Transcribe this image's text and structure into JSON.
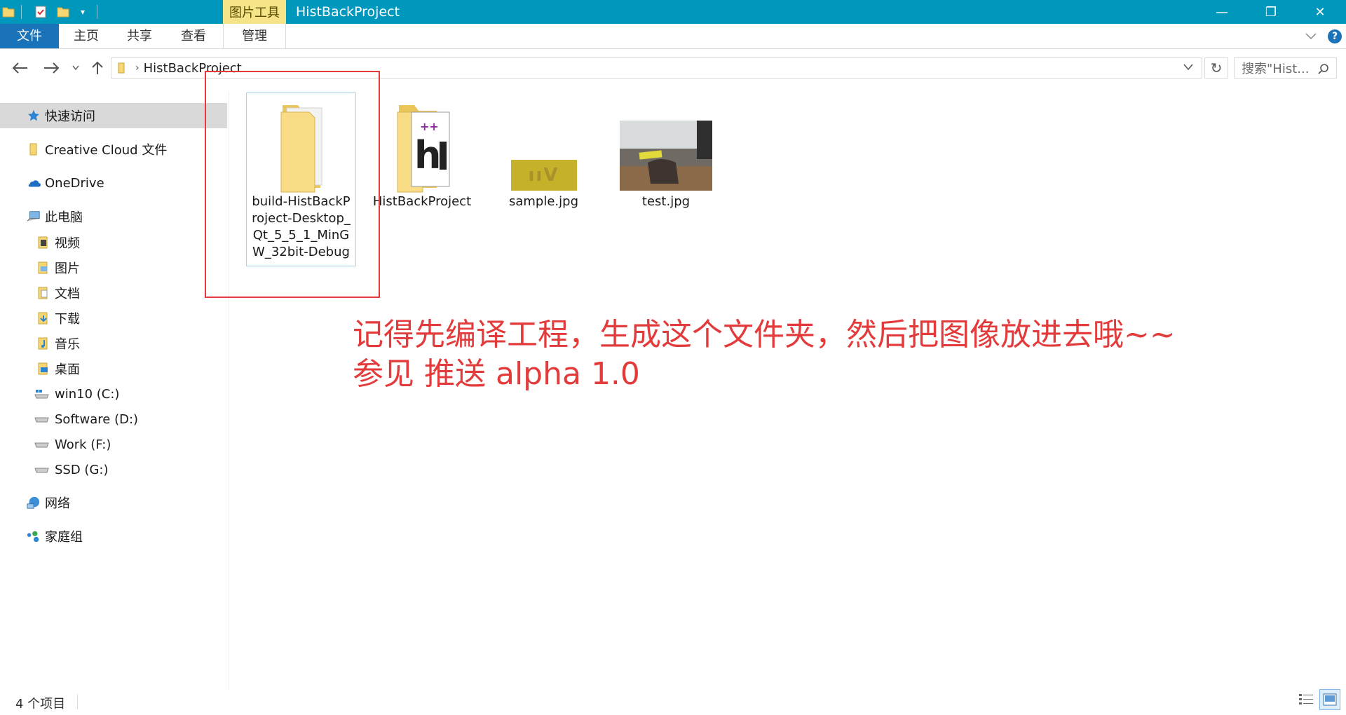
{
  "titlebar": {
    "context_tab": "图片工具",
    "window_title": "HistBackProject",
    "minimize": "—",
    "restore": "❐",
    "close": "✕"
  },
  "ribbon": {
    "tabs": [
      "文件",
      "主页",
      "共享",
      "查看",
      "管理"
    ],
    "help": "?"
  },
  "address": {
    "path": "HistBackProject",
    "search_placeholder": "搜索\"Hist..."
  },
  "sidebar": {
    "items": [
      {
        "label": "快速访问",
        "icon": "star-icon"
      },
      {
        "label": "Creative Cloud 文件",
        "icon": "folder-icon"
      },
      {
        "label": "OneDrive",
        "icon": "cloud-icon"
      },
      {
        "label": "此电脑",
        "icon": "computer-icon"
      },
      {
        "label": "视频",
        "icon": "video-folder-icon"
      },
      {
        "label": "图片",
        "icon": "pictures-folder-icon"
      },
      {
        "label": "文档",
        "icon": "documents-folder-icon"
      },
      {
        "label": "下载",
        "icon": "downloads-folder-icon"
      },
      {
        "label": "音乐",
        "icon": "music-folder-icon"
      },
      {
        "label": "桌面",
        "icon": "desktop-folder-icon"
      },
      {
        "label": "win10 (C:)",
        "icon": "drive-icon"
      },
      {
        "label": "Software (D:)",
        "icon": "drive-icon"
      },
      {
        "label": "Work (F:)",
        "icon": "drive-icon"
      },
      {
        "label": "SSD (G:)",
        "icon": "drive-icon"
      },
      {
        "label": "网络",
        "icon": "network-icon"
      },
      {
        "label": "家庭组",
        "icon": "homegroup-icon"
      }
    ]
  },
  "files": [
    {
      "label": "build-HistBackProject-Desktop_Qt_5_5_1_MinGW_32bit-Debug",
      "lines": [
        "build-HistBackP",
        "roject-Desktop_",
        "Qt_5_5_1_MinG",
        "W_32bit-Debug"
      ],
      "type": "folder"
    },
    {
      "label": "HistBackProject",
      "type": "qt-project-folder"
    },
    {
      "label": "sample.jpg",
      "type": "image",
      "thumb_text": "ııV"
    },
    {
      "label": "test.jpg",
      "type": "image"
    }
  ],
  "annotation": {
    "line1": "记得先编译工程，生成这个文件夹，然后把图像放进去哦~~",
    "line2_prefix": "参见 推送 ",
    "line2_suffix": "alpha 1.0"
  },
  "status": {
    "item_count": "4 个项目"
  },
  "colors": {
    "titlebar": "#0097bd",
    "file_tab": "#1a73b8",
    "context_tab": "#f5e588",
    "annotation": "#e33b3b",
    "folder": "#f7d774"
  }
}
